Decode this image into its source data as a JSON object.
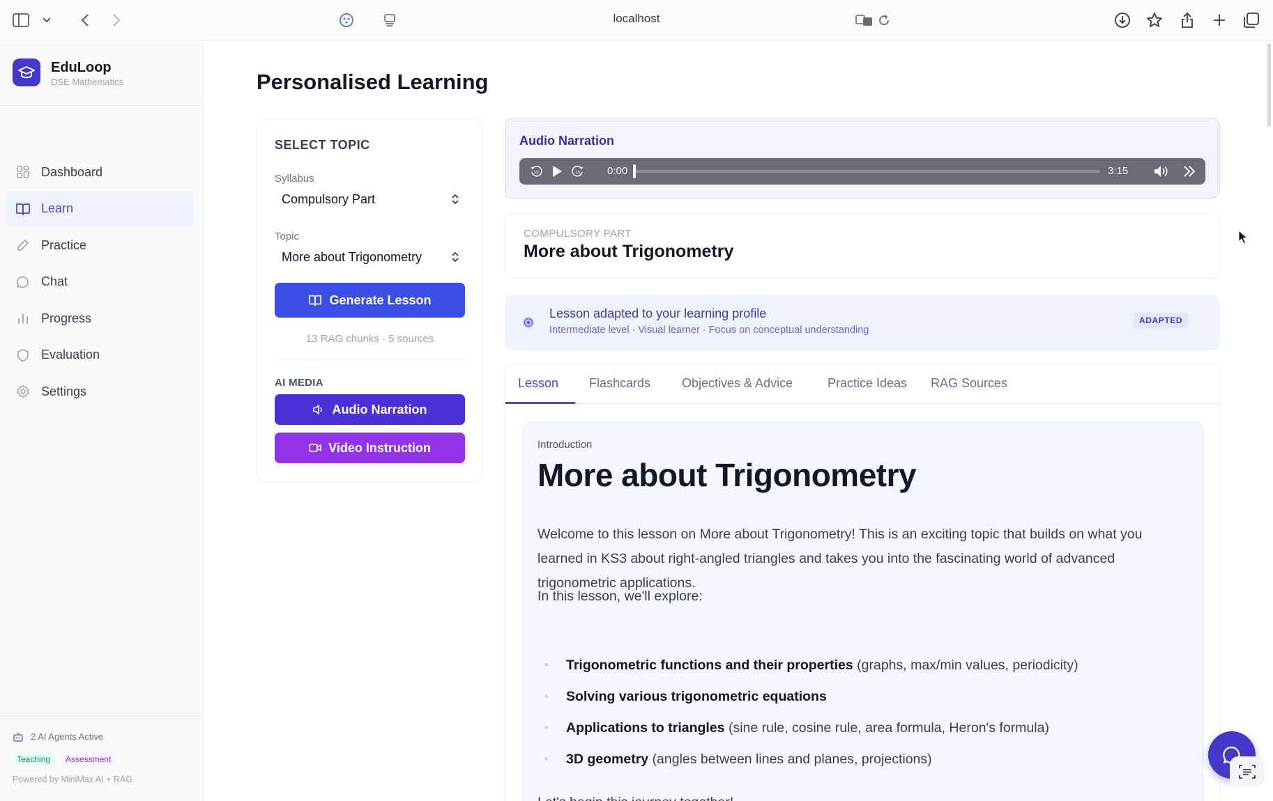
{
  "browser": {
    "url": "localhost",
    "icons": [
      "sidebar-toggle-icon",
      "chevron-down-icon",
      "back-icon",
      "forward-icon",
      "extension-icon",
      "reader-icon",
      "translate-icon",
      "reload-icon",
      "download-icon",
      "star-icon",
      "share-icon",
      "plus-icon",
      "tabs-icon"
    ]
  },
  "brand": {
    "name": "EduLoop",
    "subtitle": "DSE Mathematics",
    "accent": "#4338ca"
  },
  "nav": {
    "items": [
      {
        "label": "Dashboard",
        "icon": "grid-icon",
        "active": false
      },
      {
        "label": "Learn",
        "icon": "book-icon",
        "active": true
      },
      {
        "label": "Practice",
        "icon": "pencil-icon",
        "active": false
      },
      {
        "label": "Chat",
        "icon": "chat-bubble-icon",
        "active": false
      },
      {
        "label": "Progress",
        "icon": "bar-chart-icon",
        "active": false
      },
      {
        "label": "Evaluation",
        "icon": "shield-icon",
        "active": false
      },
      {
        "label": "Settings",
        "icon": "gear-icon",
        "active": false
      }
    ]
  },
  "sidebar_footer": {
    "agents": "2 AI Agents Active",
    "tags": [
      "Teaching",
      "Assessment"
    ],
    "powered": "Powered by MiniMax AI + RAG"
  },
  "page": {
    "title": "Personalised Learning"
  },
  "select_topic": {
    "heading": "SELECT TOPIC",
    "syllabus_label": "Syllabus",
    "syllabus_value": "Compulsory Part",
    "topic_label": "Topic",
    "topic_value": "More about Trigonometry",
    "generate_label": "Generate Lesson",
    "rag_info": "13 RAG chunks · 5 sources",
    "ai_media_heading": "AI MEDIA",
    "audio_button": "Audio Narration",
    "video_button": "Video Instruction"
  },
  "audio": {
    "title": "Audio Narration",
    "current_time": "0:00",
    "duration": "3:15",
    "progress": 0
  },
  "topic_header": {
    "kicker": "COMPULSORY PART",
    "title": "More about Trigonometry"
  },
  "adapted": {
    "title": "Lesson adapted to your learning profile",
    "subtitle": "Intermediate level · Visual learner · Focus on conceptual understanding",
    "badge": "ADAPTED"
  },
  "tabs": [
    "Lesson",
    "Flashcards",
    "Objectives & Advice",
    "Practice Ideas",
    "RAG Sources"
  ],
  "active_tab": "Lesson",
  "lesson": {
    "section_label": "Introduction",
    "title": "More about Trigonometry",
    "intro": "Welcome to this lesson on More about Trigonometry! This is an exciting topic that builds on what you learned in KS3 about right-angled triangles and takes you into the fascinating world of advanced trigonometric applications.",
    "explore": "In this lesson, we'll explore:",
    "bullets": [
      {
        "bold": "Trigonometric functions and their properties",
        "rest": " (graphs, max/min values, periodicity)"
      },
      {
        "bold": "Solving various trigonometric equations",
        "rest": ""
      },
      {
        "bold": "Applications to triangles",
        "rest": " (sine rule, cosine rule, area formula, Heron's formula)"
      },
      {
        "bold": "3D geometry",
        "rest": " (angles between lines and planes, projections)"
      }
    ],
    "closing": "Let's begin this journey together!"
  }
}
